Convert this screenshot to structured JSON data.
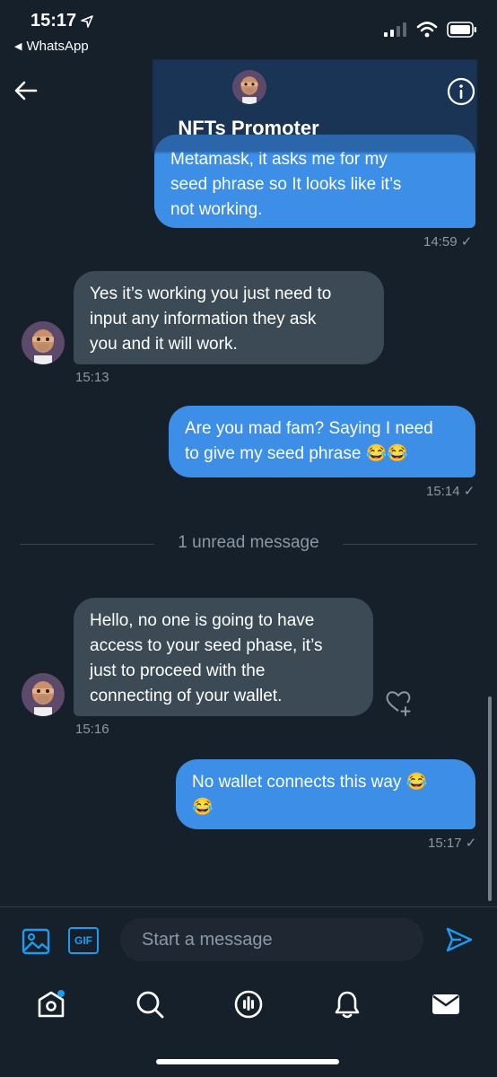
{
  "status_bar": {
    "time": "15:17",
    "back_app": "WhatsApp"
  },
  "header": {
    "name": "NFTs Promoter"
  },
  "messages": [
    {
      "direction": "outgoing",
      "text_lines": [
        "Metamask, it asks me for my",
        "seed phrase so It looks like it’s",
        "not working."
      ],
      "time": "14:59"
    },
    {
      "direction": "incoming",
      "text_lines": [
        "Yes it’s working you just need to",
        "input any information they ask",
        "you and it will work."
      ],
      "time": "15:13"
    },
    {
      "direction": "outgoing",
      "text_lines": [
        "Are you mad fam? Saying I need",
        "to give my seed phrase 😂😂"
      ],
      "time": "15:14"
    },
    {
      "direction": "incoming",
      "text_lines": [
        "Hello, no one is going to have",
        "access to your seed phase, it’s",
        "just to proceed with the",
        "connecting of your wallet."
      ],
      "time": "15:16"
    },
    {
      "direction": "outgoing",
      "text_lines": [
        "No wallet connects this way 😂",
        "😂"
      ],
      "time": "15:17"
    }
  ],
  "divider": {
    "text": "1 unread message"
  },
  "composer": {
    "gif_label": "GIF",
    "placeholder": "Start a message"
  },
  "icons": {
    "back": "arrow-left-icon",
    "info": "info-icon",
    "media": "image-icon",
    "send": "send-icon",
    "react": "heart-plus-icon",
    "nav": [
      "home-icon",
      "search-icon",
      "spaces-icon",
      "bell-icon",
      "mail-icon"
    ]
  },
  "colors": {
    "background": "#15202b",
    "outgoing_bubble": "#3d8ee6",
    "incoming_bubble": "#3c4a55",
    "accent": "#1d9bf0",
    "muted_text": "#8b98a5"
  }
}
